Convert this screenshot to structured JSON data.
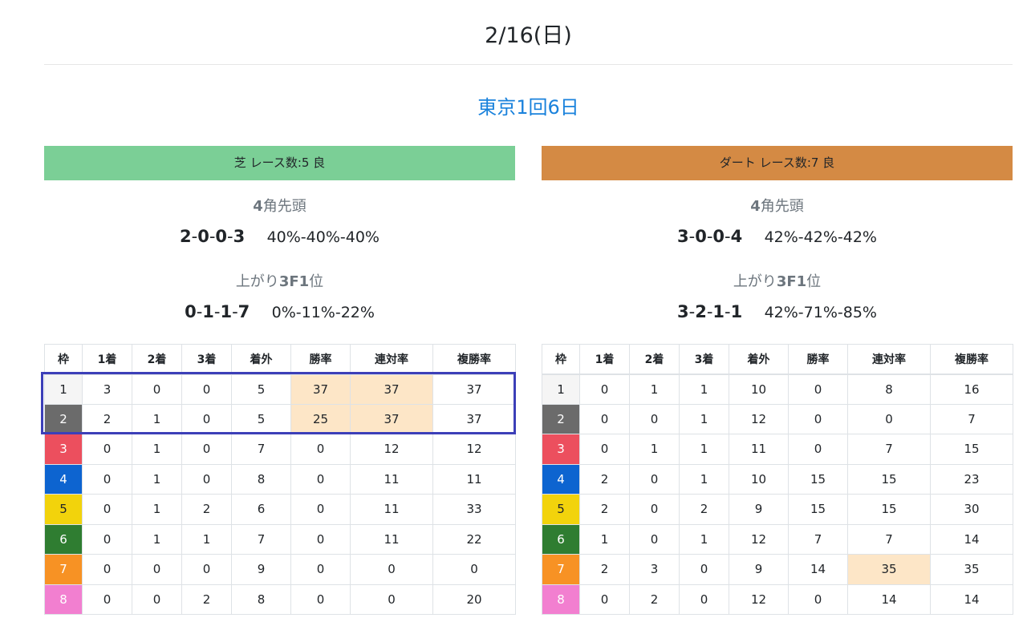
{
  "page": {
    "date": "2/16(日)",
    "meeting": "東京1回6日"
  },
  "colors": {
    "turf": "#7bcf96",
    "dirt": "#d48a44",
    "link": "#1a82dc",
    "highlight_cell": "#fde6c7",
    "selection_box": "#3c3fb8"
  },
  "turf": {
    "header": "芝 レース数:5 良",
    "front_label_num": "4",
    "front_label_text": "角先頭",
    "front_record": [
      "2",
      "0",
      "0",
      "3"
    ],
    "front_pct": "40%-40%-40%",
    "last3f_label_text": "上がり",
    "last3f_label_num": "3F1",
    "last3f_label_suffix": "位",
    "last3f_record": [
      "0",
      "1",
      "1",
      "7"
    ],
    "last3f_pct": "0%-11%-22%",
    "columns": [
      "枠",
      "1着",
      "2着",
      "3着",
      "着外",
      "勝率",
      "連対率",
      "複勝率"
    ],
    "rows": [
      [
        "1",
        "3",
        "0",
        "0",
        "5",
        "37",
        "37",
        "37"
      ],
      [
        "2",
        "2",
        "1",
        "0",
        "5",
        "25",
        "37",
        "37"
      ],
      [
        "3",
        "0",
        "1",
        "0",
        "7",
        "0",
        "12",
        "12"
      ],
      [
        "4",
        "0",
        "1",
        "0",
        "8",
        "0",
        "11",
        "11"
      ],
      [
        "5",
        "0",
        "1",
        "2",
        "6",
        "0",
        "11",
        "33"
      ],
      [
        "6",
        "0",
        "1",
        "1",
        "7",
        "0",
        "11",
        "22"
      ],
      [
        "7",
        "0",
        "0",
        "0",
        "9",
        "0",
        "0",
        "0"
      ],
      [
        "8",
        "0",
        "0",
        "2",
        "8",
        "0",
        "0",
        "20"
      ]
    ]
  },
  "dirt": {
    "header": "ダート レース数:7 良",
    "front_label_num": "4",
    "front_label_text": "角先頭",
    "front_record": [
      "3",
      "0",
      "0",
      "4"
    ],
    "front_pct": "42%-42%-42%",
    "last3f_label_text": "上がり",
    "last3f_label_num": "3F1",
    "last3f_label_suffix": "位",
    "last3f_record": [
      "3",
      "2",
      "1",
      "1"
    ],
    "last3f_pct": "42%-71%-85%",
    "columns": [
      "枠",
      "1着",
      "2着",
      "3着",
      "着外",
      "勝率",
      "連対率",
      "複勝率"
    ],
    "rows": [
      [
        "1",
        "0",
        "1",
        "1",
        "10",
        "0",
        "8",
        "16"
      ],
      [
        "2",
        "0",
        "0",
        "1",
        "12",
        "0",
        "0",
        "7"
      ],
      [
        "3",
        "0",
        "1",
        "1",
        "11",
        "0",
        "7",
        "15"
      ],
      [
        "4",
        "2",
        "0",
        "1",
        "10",
        "15",
        "15",
        "23"
      ],
      [
        "5",
        "2",
        "0",
        "2",
        "9",
        "15",
        "15",
        "30"
      ],
      [
        "6",
        "1",
        "0",
        "1",
        "12",
        "7",
        "7",
        "14"
      ],
      [
        "7",
        "2",
        "3",
        "0",
        "9",
        "14",
        "35",
        "35"
      ],
      [
        "8",
        "0",
        "2",
        "0",
        "12",
        "0",
        "14",
        "14"
      ]
    ]
  }
}
